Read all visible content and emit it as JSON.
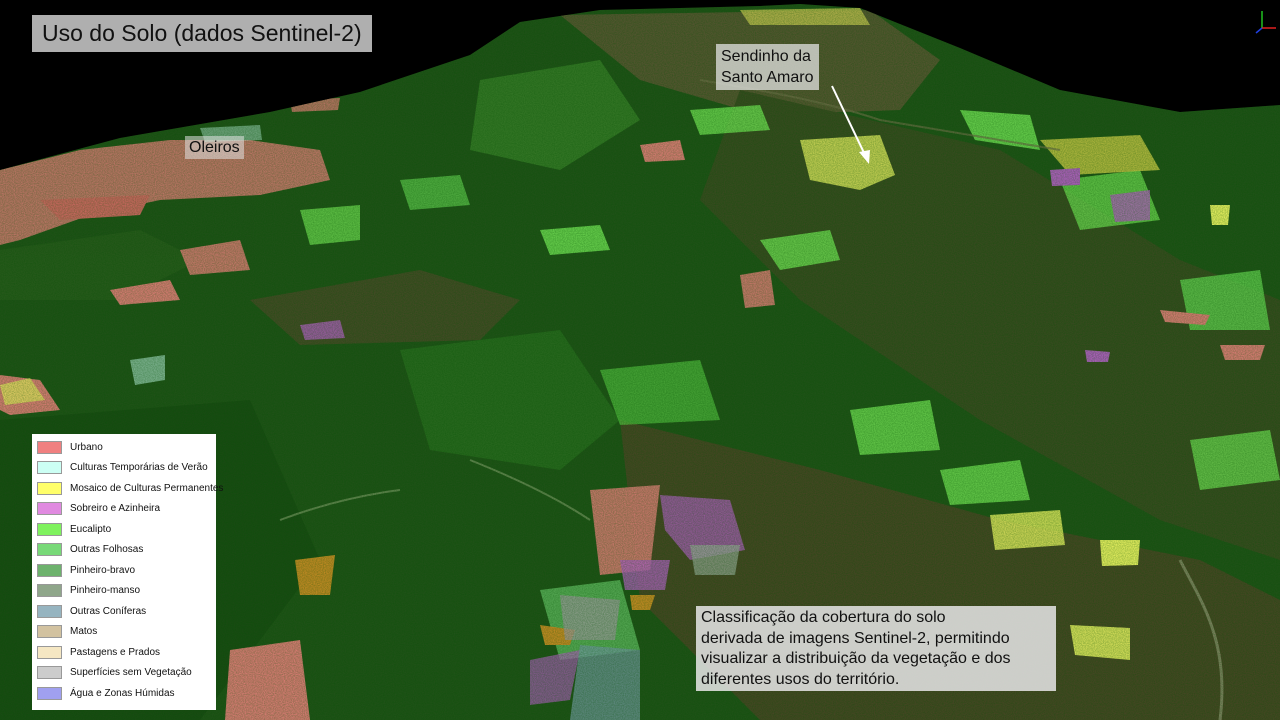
{
  "title": "Uso do Solo (dados Sentinel-2)",
  "places": {
    "oleiros": "Oleiros",
    "sendinho": [
      "Sendinho da",
      "Santo Amaro"
    ]
  },
  "legend": [
    {
      "label": "Urbano",
      "color": "#f08080"
    },
    {
      "label": "Culturas Temporárias de Verão",
      "color": "#ccfff4"
    },
    {
      "label": "Mosaico de Culturas Permanentes",
      "color": "#ffff6a"
    },
    {
      "label": "Sobreiro e Azinheira",
      "color": "#e08ae0"
    },
    {
      "label": "Eucalipto",
      "color": "#7ff25e"
    },
    {
      "label": "Outras Folhosas",
      "color": "#78d978"
    },
    {
      "label": "Pinheiro-bravo",
      "color": "#6db26d"
    },
    {
      "label": "Pinheiro-manso",
      "color": "#8fa68a"
    },
    {
      "label": "Outras Coníferas",
      "color": "#96b4c0"
    },
    {
      "label": "Matos",
      "color": "#d2c2a0"
    },
    {
      "label": "Pastagens e Prados",
      "color": "#f5e7c3"
    },
    {
      "label": "Superfícies sem Vegetação",
      "color": "#cccccc"
    },
    {
      "label": "Água e Zonas Húmidas",
      "color": "#a0a0f0"
    }
  ],
  "description": [
    "Classificação da cobertura do solo",
    "derivada de imagens Sentinel-2, permitindo",
    "visualizar a distribuição da vegetação e dos",
    "diferentes usos do território."
  ],
  "colors": {
    "sky": "#000000",
    "forest_dark": "#1f4a17",
    "forest_mid": "#2f6a22",
    "bare_ground": "#5a4a2a",
    "axis_x": "#e02020",
    "axis_y": "#20c020",
    "axis_z": "#2040e0"
  }
}
